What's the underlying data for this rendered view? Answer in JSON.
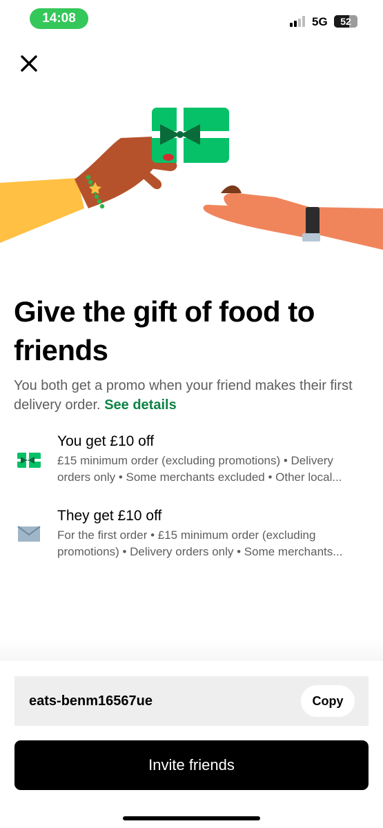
{
  "status_bar": {
    "time": "14:08",
    "network": "5G",
    "battery": "52"
  },
  "header": {
    "close_icon": "close-icon"
  },
  "colors": {
    "accent_green": "#06c167",
    "link_green": "#0e8345",
    "primary_button": "#000000"
  },
  "hero": {
    "illustration": "gift-card-hands-illustration"
  },
  "headline": {
    "line1": "Give the gift of food to",
    "line2": "friends"
  },
  "subtext": {
    "text": "You both get a promo when your friend makes their first delivery order.",
    "link": "See details"
  },
  "benefits": [
    {
      "icon": "gift-card-icon",
      "title": "You get £10 off",
      "desc_line1": "£15 minimum order (excluding promotions) • Delivery",
      "desc_line2": "orders only • Some merchants excluded • Other local..."
    },
    {
      "icon": "envelope-icon",
      "title": "They get £10 off",
      "desc_line1": "For the first order • £15 minimum order (excluding",
      "desc_line2": "promotions) • Delivery orders only • Some merchants..."
    }
  ],
  "invite": {
    "code": "eats-benm16567ue",
    "copy_label": "Copy",
    "button_label": "Invite friends"
  }
}
